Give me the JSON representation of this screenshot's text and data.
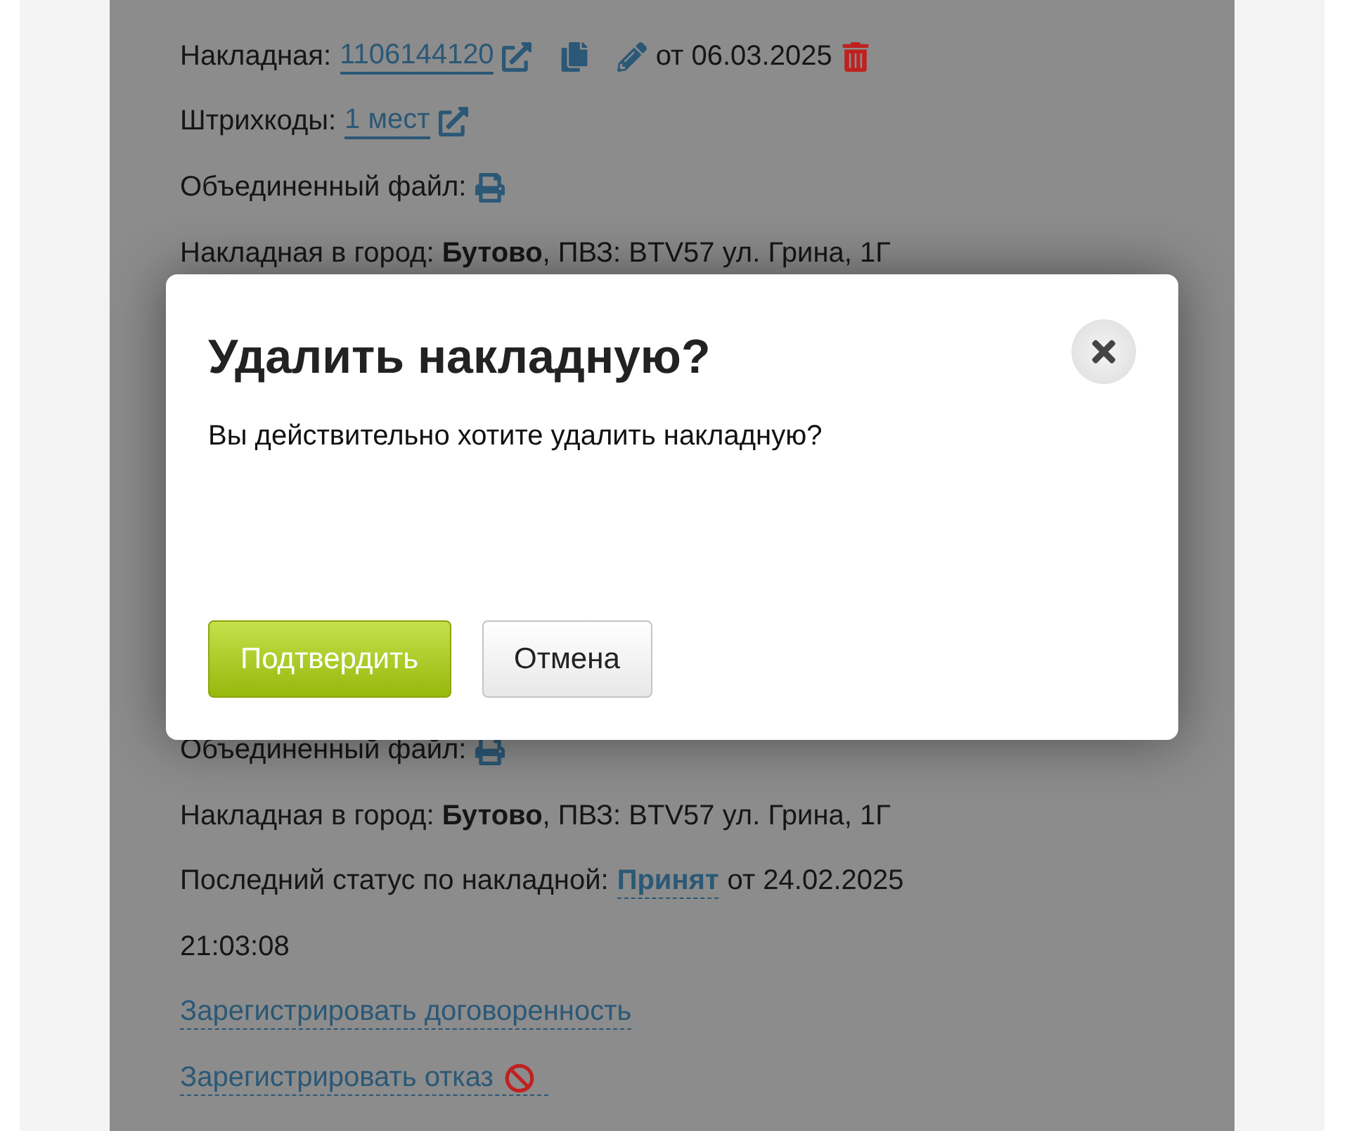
{
  "page": {
    "top_section": {
      "waybill": {
        "label": "Накладная:",
        "number": "1106144120",
        "date_text": "от 06.03.2025"
      },
      "barcodes": {
        "label": "Штрихкоды:",
        "link": "1 мест"
      },
      "merged_file": {
        "label": "Объединенный файл:"
      },
      "city": {
        "text": "Накладная в город: **Бутово**, ПВЗ: BTV57 ул. Грина, 1Г"
      }
    },
    "bottom_section": {
      "merged_file": {
        "label": "Объединенный файл:"
      },
      "city": {
        "text": "Накладная в город: **Бутово**, ПВЗ: BTV57 ул. Грина, 1Г"
      },
      "last_status": {
        "label": "Последний статус по накладной:",
        "status": "Принят",
        "date_text": "от 24.02.2025",
        "time": "21:03:08"
      },
      "actions": [
        {
          "label": "Зарегистрировать договоренность",
          "kind": "plain"
        },
        {
          "label": "Зарегистрировать отказ",
          "kind": "refuse"
        }
      ]
    }
  },
  "dialog": {
    "title": "Удалить накладную?",
    "message": "Вы действительно хотите удалить накладную?",
    "buttons": [
      {
        "label": "Подтвердить",
        "kind": "primary"
      },
      {
        "label": "Отмена",
        "kind": "secondary"
      }
    ]
  }
}
